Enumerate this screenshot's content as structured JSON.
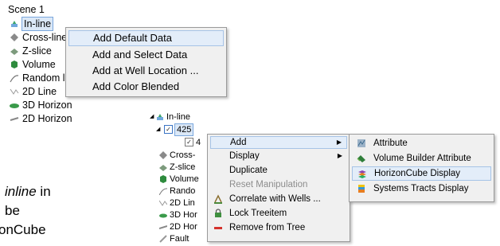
{
  "scene_tree": {
    "title": "Scene 1",
    "items": [
      "In-line",
      "Cross-line",
      "Z-slice",
      "Volume",
      "Random line",
      "2D Line",
      "3D Horizon",
      "2D Horizon"
    ]
  },
  "context_menu_1": {
    "items": [
      "Add Default Data",
      "Add and Select Data",
      "Add at Well Location ...",
      "Add Color Blended"
    ],
    "highlighted_index": 0
  },
  "doc_text": {
    "line1_prefix": "",
    "line1_italic": "inline",
    "line1_suffix": " in",
    "line2": "be",
    "line3": "onCube"
  },
  "tree_2": {
    "items": [
      "In-line",
      "425",
      "4",
      "Cross-",
      "Z-slice",
      "Volume",
      "Rando",
      "2D Lin",
      "3D Hor",
      "2D Hor",
      "Fault"
    ]
  },
  "context_menu_2": {
    "items": [
      {
        "label": "Add",
        "submenu": true,
        "icon": ""
      },
      {
        "label": "Display",
        "submenu": true,
        "icon": ""
      },
      {
        "label": "Duplicate",
        "submenu": false,
        "icon": ""
      },
      {
        "label": "Reset Manipulation",
        "submenu": false,
        "icon": "",
        "disabled": true
      },
      {
        "label": "Correlate with Wells ...",
        "submenu": false,
        "icon": "wells-icon"
      },
      {
        "label": "Lock Treeitem",
        "submenu": false,
        "icon": "lock-icon"
      },
      {
        "label": "Remove from Tree",
        "submenu": false,
        "icon": "remove-icon"
      }
    ],
    "highlighted_index": 0
  },
  "context_menu_3": {
    "items": [
      {
        "label": "Attribute",
        "icon": "attribute-icon"
      },
      {
        "label": "Volume Builder Attribute",
        "icon": "volume-builder-icon"
      },
      {
        "label": "HorizonCube Display",
        "icon": "horizoncube-icon"
      },
      {
        "label": "Systems Tracts Display",
        "icon": "systems-tracts-icon"
      }
    ],
    "highlighted_index": 2
  },
  "colors": {
    "menu_bg": "#f0f0f0",
    "highlight_bg": "#e3edf9",
    "highlight_border": "#a6c3e6",
    "disabled_text": "#8d8d8d"
  }
}
